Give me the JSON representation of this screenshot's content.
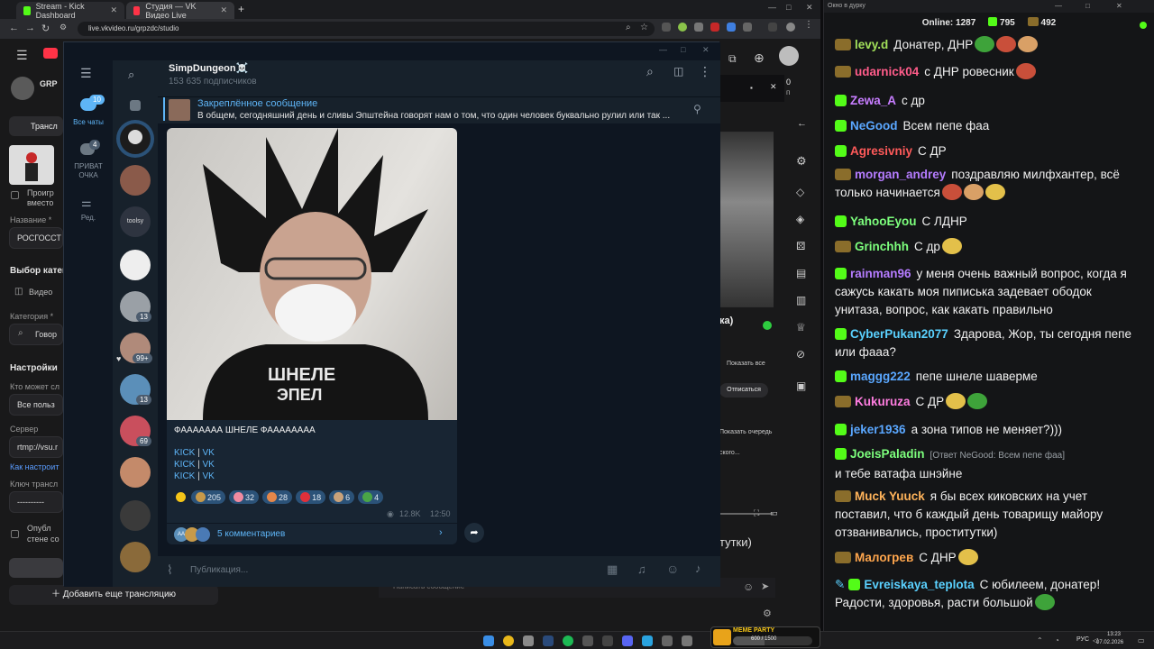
{
  "browser": {
    "tabs": [
      {
        "label": "Stream - Kick Dashboard",
        "color": "#53fc18"
      },
      {
        "label": "Студия — VK Видео Live",
        "color": "#ff3347"
      }
    ],
    "new_tab": "+",
    "url": "live.vkvideo.ru/grpzdc/studio",
    "window_controls": [
      "—",
      "□",
      "✕"
    ]
  },
  "vk_studio": {
    "channel_short": "GRP",
    "tab_stream": "Трансл",
    "checkbox1": "Проигр",
    "checkbox1_b": "вместо",
    "name_label": "Название *",
    "name_value": "РОСГОССТ",
    "category_section": "Выбор катег",
    "video_item": "Видео",
    "category_label": "Категория *",
    "category_value": "Говор",
    "settings": "Настройки",
    "who_can": "Кто может сл",
    "who_value": "Все польз",
    "server_label": "Сервер",
    "server_value": "rtmp://vsu.r",
    "how_config": "Как настроит",
    "key_label": "Ключ трансл",
    "key_value": "----------",
    "publish1": "Опубл",
    "publish2": "стене со",
    "add_more": "Добавить еще трансляцию",
    "right_show_all": "Показать все",
    "right_unsub": "Отписаться",
    "right_show_queue": "Показать очередь",
    "right_partial1": "ка)",
    "right_partial2": "ского...",
    "right_partial3": "тутки)",
    "write_message": "Написать сообщение",
    "right_count": "0",
    "right_count_sub": "п"
  },
  "telegram": {
    "folders": [
      {
        "label": "Все чаты",
        "badge": "10"
      },
      {
        "label": "ПРИВАТ ОЧКА",
        "badge": "4"
      },
      {
        "label": "Ред.",
        "badge": ""
      }
    ],
    "chat_badges": [
      "13",
      "99+",
      "13",
      "69"
    ],
    "chat_label_toolsy": "toolsy",
    "channel_name": "SimpDungeon☠️",
    "subscribers": "153 635 подписчиков",
    "pinned_title": "Закреплённое сообщение",
    "pinned_text": "В общем, сегодняшний день и сливы Эпштейна говорят нам о том, что один человек буквально рулил или так ...",
    "post": {
      "text": "ФААААААА ШНЕЛЕ ФАААААААА",
      "shirt_text": "ШНЕЛЕ\nЭПЕЛ",
      "links": [
        {
          "a": "KICK",
          "sep": " | ",
          "b": "VK"
        },
        {
          "a": "KICK",
          "sep": " | ",
          "b": "VK"
        },
        {
          "a": "KICK",
          "sep": " | ",
          "b": "VK"
        }
      ],
      "reactions": [
        {
          "emoji": "star",
          "count": "",
          "color": "#f5c518"
        },
        {
          "emoji": "meme1",
          "count": "205",
          "color": "#c79a4a"
        },
        {
          "emoji": "pig",
          "count": "32",
          "color": "#f08aa0"
        },
        {
          "emoji": "fox",
          "count": "28",
          "color": "#e4874a"
        },
        {
          "emoji": "heart",
          "count": "18",
          "color": "#e0303a"
        },
        {
          "emoji": "cat",
          "count": "6",
          "color": "#c9a27a"
        },
        {
          "emoji": "frog",
          "count": "4",
          "color": "#4aa547"
        }
      ],
      "views": "12.8K",
      "time": "12:50",
      "comments": "5 комментариев",
      "commenter_initials": "АА"
    },
    "input_placeholder": "Публикация..."
  },
  "chat": {
    "window_title": "Окно в дурку",
    "online_label": "Online:",
    "online_value": "1287",
    "kick_count": "795",
    "sub_count": "492",
    "messages": [
      {
        "badge": "sub",
        "user": "levy.d",
        "color": "#a2e05a",
        "text": "Донатер, ДНР",
        "emotes": 3
      },
      {
        "badge": "sub",
        "user": "udarnick04",
        "color": "#ff5c8a",
        "text": "с ДНР ровесник",
        "emotes": 1
      },
      {
        "badge": "kick",
        "user": "Zewa_A",
        "color": "#c77dff",
        "text": "с др",
        "emotes": 0
      },
      {
        "badge": "kick",
        "user": "NeGood",
        "color": "#5aa7ff",
        "text": "Всем пепе фаа",
        "emotes": 0
      },
      {
        "badge": "kick",
        "user": "Agresivniy",
        "color": "#ff5a5a",
        "text": "С ДР",
        "emotes": 0
      },
      {
        "badge": "sub",
        "user": "morgan_andrey",
        "color": "#b57cff",
        "text": "поздравляю милфхантер, всё только начинается",
        "emotes": 3
      },
      {
        "badge": "kick",
        "user": "YahooEyou",
        "color": "#7dff7d",
        "text": "С ЛДНР",
        "emotes": 0
      },
      {
        "badge": "sub",
        "user": "Grinchhh",
        "color": "#7dff7d",
        "text": "С др",
        "emotes": 1
      },
      {
        "badge": "kick",
        "user": "rainman96",
        "color": "#b57cff",
        "text": "у меня очень важный вопрос, когда я сажусь какать моя пиписька задевает ободок унитаза, вопрос, как какать правильно",
        "emotes": 0
      },
      {
        "badge": "kick",
        "user": "CyberPukan2077",
        "color": "#5ad1ff",
        "text": "Здарова, Жор, ты сегодня пепе или фааа?",
        "emotes": 0
      },
      {
        "badge": "kick",
        "user": "maggg222",
        "color": "#5aa7ff",
        "text": "пепе шнеле шаверме",
        "emotes": 0
      },
      {
        "badge": "sub",
        "user": "Kukuruza",
        "color": "#ff7de0",
        "text": "С ДР",
        "emotes": 2
      },
      {
        "badge": "kick",
        "user": "jeker1936",
        "color": "#5aa7ff",
        "text": "а зона типов не меняет?)))",
        "emotes": 0
      },
      {
        "badge": "kick",
        "user": "JoeisPaladin",
        "color": "#7dff7d",
        "reply": "[Ответ NeGood: Всем пепе фаа]",
        "text": "и тебе ватафа шнэйне",
        "emotes": 0
      },
      {
        "badge": "sub",
        "user": "Muck Yuuck",
        "color": "#ffb35a",
        "text": "я бы всех киковских на учет поставил, что б каждый день товарищу майору отзванивались, проститутки)",
        "emotes": 0
      },
      {
        "badge": "sub",
        "user": "Малогрев",
        "color": "#ffa64d",
        "text": "С ДНР",
        "emotes": 1
      },
      {
        "badge": "kick",
        "user": "Evreiskaya_teplota",
        "color": "#5ad1ff",
        "text": "С юбилеем, донатер! Радости, здоровья, расти большой",
        "emotes": 1
      }
    ]
  },
  "taskbar": {
    "meme_party": "MEME PARTY",
    "meme_progress_text": "600 / 1500",
    "lang": "РУС",
    "time": "13:23",
    "date": "07.02.2026"
  }
}
